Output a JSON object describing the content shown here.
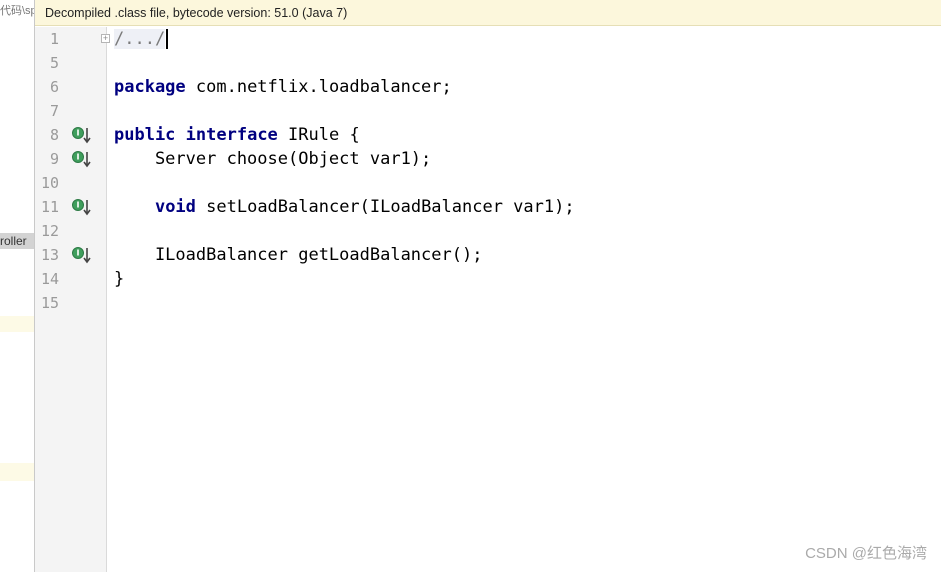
{
  "left_panel": {
    "path_fragment": "代码\\sp",
    "tab_fragment": "roller"
  },
  "banner": {
    "text": "Decompiled .class file, bytecode version: 51.0 (Java 7)"
  },
  "editor": {
    "line_numbers": [
      "1",
      "5",
      "6",
      "7",
      "8",
      "9",
      "10",
      "11",
      "12",
      "13",
      "14",
      "15"
    ],
    "lines": {
      "l1": "/.../",
      "l6_kw": "package",
      "l6_rest": " com.netflix.loadbalancer;",
      "l8_kw1": "public",
      "l8_kw2": "interface",
      "l8_rest": " IRule {",
      "l9": "    Server choose(Object var1);",
      "l11_indent": "    ",
      "l11_kw": "void",
      "l11_rest": " setLoadBalancer(ILoadBalancer var1);",
      "l13": "    ILoadBalancer getLoadBalancer();",
      "l14": "}"
    },
    "fold_toggle": "+"
  },
  "watermark": "CSDN @红色海湾",
  "colors": {
    "keyword": "#000080",
    "banner_bg": "#fcf7dc",
    "marker_green": "#3f9e5c"
  },
  "icons": [
    "implementing-method-icon"
  ]
}
